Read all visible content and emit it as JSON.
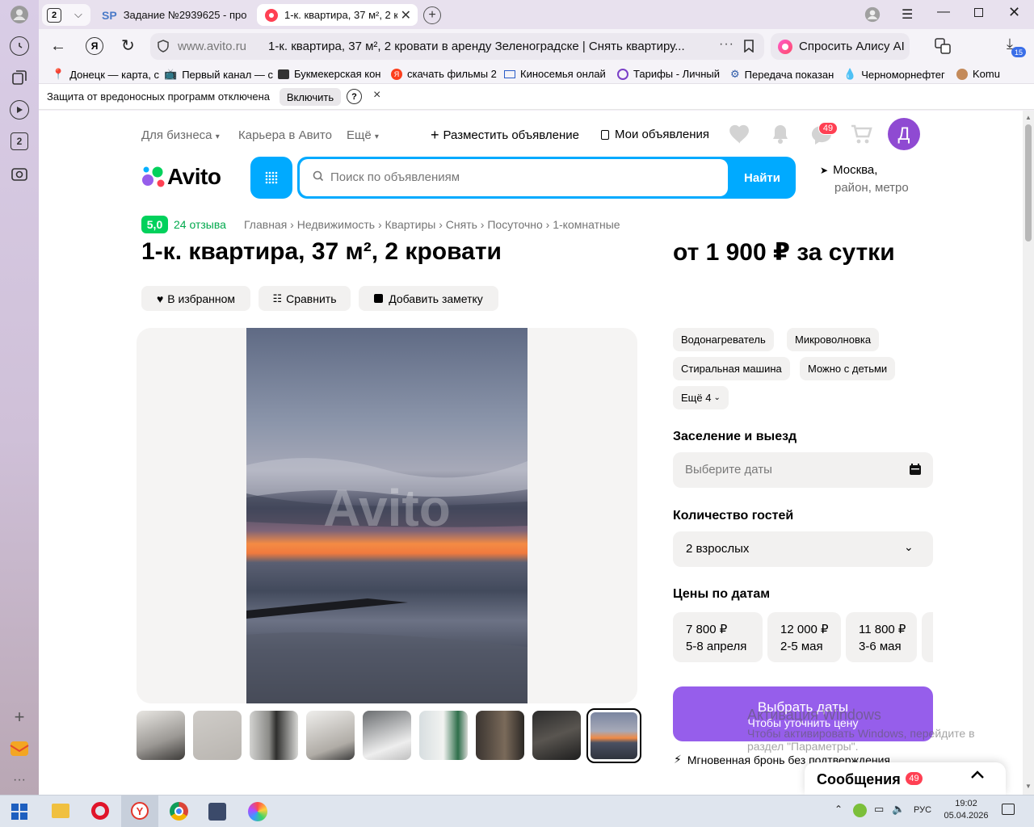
{
  "browser": {
    "tab_count": "2",
    "tabs": [
      {
        "favicon": "SP",
        "title": "Задание №2939625 - про"
      },
      {
        "title": "1-к. квартира, 37 м², 2 к"
      }
    ],
    "address_domain": "www.avito.ru",
    "address_title": "1-к. квартира, 37 м², 2 кровати в аренду Зеленоградске | Снять квартиру...",
    "alice_label": "Спросить Алису AI",
    "downloads_count": "15",
    "bookmarks": [
      "Донецк — карта, с",
      "Первый канал — с",
      "Букмекерская кон",
      "скачать фильмы 2",
      "Киносемья онлай",
      "Тарифы - Личный",
      "Передача показан",
      "Черноморнефтег",
      "Komu"
    ],
    "protection_text": "Защита от вредоносных программ отключена",
    "protection_button": "Включить",
    "protection_help": "?",
    "protection_close": "×"
  },
  "header": {
    "nav": [
      "Для бизнеса",
      "Карьера в Авито",
      "Ещё"
    ],
    "post_ad": "Разместить объявление",
    "my_ads": "Мои объявления",
    "messages_badge": "49",
    "avatar_letter": "Д",
    "logo_text": "Avito",
    "search_placeholder": "Поиск по объявлениям",
    "search_button": "Найти",
    "location_line1": "Москва,",
    "location_line2": "район, метро"
  },
  "listing": {
    "rating": "5,0",
    "reviews": "24 отзыва",
    "breadcrumbs": [
      "Главная",
      "Недвижимость",
      "Квартиры",
      "Снять",
      "Посуточно",
      "1-комнатные"
    ],
    "title": "1-к. квартира, 37 м², 2 кровати",
    "price": "от 1 900 ₽ за сутки",
    "actions": [
      "В избранном",
      "Сравнить",
      "Добавить заметку"
    ],
    "watermark": "Avito",
    "features": [
      "Водонагреватель",
      "Микроволновка",
      "Стиральная машина",
      "Можно с детьми"
    ],
    "features_more": "Ещё 4",
    "checkin_label": "Заселение и выезд",
    "checkin_placeholder": "Выберите даты",
    "guests_label": "Количество гостей",
    "guests_value": "2 взрослых",
    "prices_label": "Цены по датам",
    "date_prices": [
      {
        "price": "7 800 ₽",
        "dates": "5-8 апреля"
      },
      {
        "price": "12 000 ₽",
        "dates": "2-5 мая"
      },
      {
        "price": "11 800 ₽",
        "dates": "3-6 мая"
      }
    ],
    "cta_main": "Выбрать даты",
    "cta_sub": "Чтобы уточнить цену",
    "instant": "Мгновенная бронь без подтверждения"
  },
  "windows_activation": {
    "title": "Активация Windows",
    "line1": "Чтобы активировать Windows, перейдите в",
    "line2": "раздел \"Параметры\"."
  },
  "messages_widget": {
    "label": "Сообщения",
    "badge": "49"
  },
  "taskbar": {
    "lang": "РУС",
    "time": "19:02",
    "date": "05.04.2026"
  },
  "colors": {
    "accent": "#00aaff",
    "purple": "#965eeb",
    "green": "#02d15c",
    "badge": "#ff4053",
    "avatar": "#8f4ad2"
  }
}
